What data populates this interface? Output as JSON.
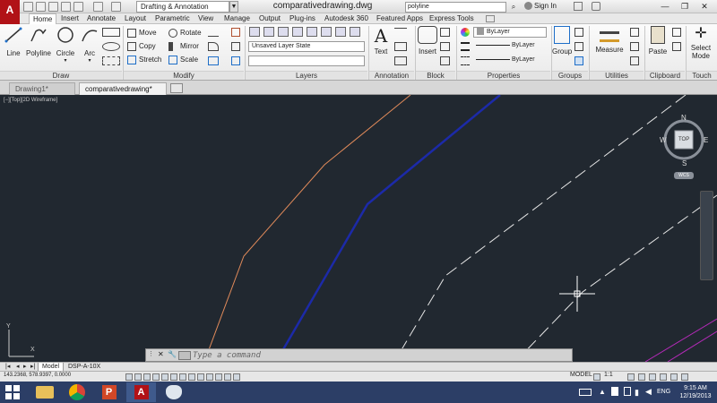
{
  "titlebar": {
    "workspace": "Drafting & Annotation",
    "document_title": "comparativedrawing.dwg",
    "search_value": "polyline",
    "signin_label": "Sign In"
  },
  "ribbon_tabs": [
    {
      "label": "Home",
      "active": true
    },
    {
      "label": "Insert"
    },
    {
      "label": "Annotate"
    },
    {
      "label": "Layout"
    },
    {
      "label": "Parametric"
    },
    {
      "label": "View"
    },
    {
      "label": "Manage"
    },
    {
      "label": "Output"
    },
    {
      "label": "Plug-ins"
    },
    {
      "label": "Autodesk 360"
    },
    {
      "label": "Featured Apps"
    },
    {
      "label": "Express Tools"
    }
  ],
  "ribbon": {
    "draw": {
      "line": "Line",
      "polyline": "Polyline",
      "circle": "Circle",
      "arc": "Arc",
      "panel": "Draw"
    },
    "modify": {
      "move": "Move",
      "rotate": "Rotate",
      "copy": "Copy",
      "mirror": "Mirror",
      "stretch": "Stretch",
      "scale": "Scale",
      "panel": "Modify"
    },
    "layers": {
      "state": "Unsaved Layer State",
      "panel": "Layers"
    },
    "annotation": {
      "text": "Text",
      "panel": "Annotation"
    },
    "block": {
      "insert": "Insert",
      "panel": "Block"
    },
    "properties": {
      "color": "ByLayer",
      "linetype": "ByLayer",
      "lineweight": "ByLayer",
      "panel": "Properties"
    },
    "groups": {
      "group": "Group",
      "panel": "Groups"
    },
    "utilities": {
      "measure": "Measure",
      "panel": "Utilities"
    },
    "clipboard": {
      "paste": "Paste",
      "panel": "Clipboard"
    },
    "touch": {
      "select_mode_1": "Select",
      "select_mode_2": "Mode",
      "panel": "Touch"
    }
  },
  "doc_tabs": [
    {
      "label": "Drawing1*"
    },
    {
      "label": "comparativedrawing*",
      "active": true
    }
  ],
  "canvas": {
    "view_label": "[−][Top][2D Wireframe]",
    "viewcube": {
      "top": "TOP",
      "n": "N",
      "s": "S",
      "e": "E",
      "w": "W",
      "ucs": "WCS"
    }
  },
  "command_line": {
    "placeholder": "Type a command"
  },
  "layout_tabs": [
    {
      "label": "Model",
      "active": true
    },
    {
      "label": "DSP-A-10X"
    }
  ],
  "status": {
    "coords": "143.2368, 578.9397, 0.0000",
    "model": "MODEL",
    "scale": "1:1"
  },
  "taskbar": {
    "lang": "ENG",
    "time": "9:15 AM",
    "date": "12/19/2013"
  },
  "colors": {
    "canvas": "#212830",
    "accent": "#b11217",
    "orange_line": "#e08a5a",
    "blue_line": "#1c2aa8",
    "taskbar": "#2c3e66"
  }
}
